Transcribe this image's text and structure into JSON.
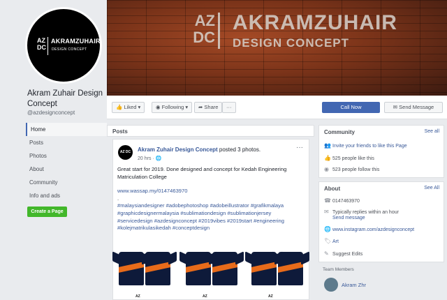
{
  "page": {
    "name": "Akram Zuhair Design Concept",
    "handle": "@azdesignconcept",
    "logo_mark": "AZ DC",
    "logo_name": "AKRAMZUHAIR",
    "logo_sub": "DESIGN CONCEPT"
  },
  "cover": {
    "mark": "AZ DC",
    "name": "AKRAMZUHAIR",
    "sub": "DESIGN CONCEPT"
  },
  "nav": {
    "items": [
      "Home",
      "Posts",
      "Photos",
      "About",
      "Community",
      "Info and ads"
    ],
    "active": "Home",
    "create_label": "Create a Page"
  },
  "actions": {
    "liked": "Liked ▾",
    "following": "Following ▾",
    "share": "Share",
    "more": "···",
    "call": "Call Now",
    "message": "Send Message"
  },
  "posts": {
    "header": "Posts",
    "post": {
      "author": "Akram Zuhair Design Concept",
      "action": " posted 3 photos.",
      "time": "20 hrs · 🌐",
      "text": "Great start for 2019. Done designed and concept for Kedah Engineering Matriculation College",
      "link": "www.wassap.my/0147463970",
      "dot": ".",
      "tags": "#malaysiandesigner #adobephotoshop #adobeillustrator #grafikmalaya #graphicdesignermalaysia #sublimationdesign #sublimationjersey #servicedesign #azdesignconcept #2019vibes #2019start #engineering #kolejmatrikulasikedah #conceptdesign",
      "jersey_tag": "AZ"
    }
  },
  "community": {
    "title": "Community",
    "see_all": "See all",
    "invite": "Invite your friends to like this Page",
    "likes": "525 people like this",
    "follows": "523 people follow this"
  },
  "about": {
    "title": "About",
    "see_all": "See All",
    "phone": "0147463970",
    "response": "Typically replies within an hour",
    "send_message": "Send message",
    "website": "www.instagram.com/azdesignconcept",
    "category": "Art",
    "suggest": "Suggest Edits"
  },
  "team": {
    "header": "Team Members",
    "member": "Akram Zhr"
  }
}
